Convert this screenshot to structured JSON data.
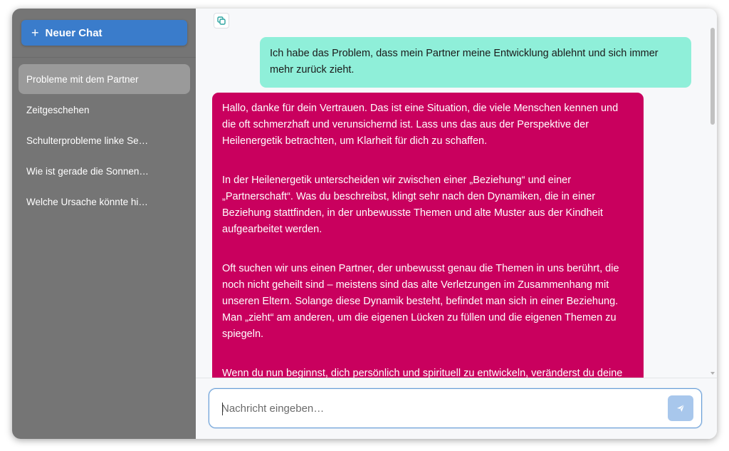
{
  "sidebar": {
    "new_chat_label": "Neuer Chat",
    "conversations": [
      {
        "label": "Probleme mit dem Partner",
        "active": true
      },
      {
        "label": "Zeitgeschehen",
        "active": false
      },
      {
        "label": "Schulterprobleme linke Se…",
        "active": false
      },
      {
        "label": "Wie ist gerade die Sonnen…",
        "active": false
      },
      {
        "label": "Welche Ursache könnte hi…",
        "active": false
      }
    ]
  },
  "chat": {
    "messages": [
      {
        "role": "user",
        "text": "Ich habe das Problem, dass mein Partner meine Entwicklung ablehnt und sich immer mehr zurück zieht."
      },
      {
        "role": "assistant",
        "paragraphs": [
          "Hallo, danke für dein Vertrauen. Das ist eine Situation, die viele Menschen kennen und die oft schmerzhaft und verunsichernd ist. Lass uns das aus der Perspektive der Heilenergetik betrachten, um Klarheit für dich zu schaffen.",
          "In der Heilenergetik unterscheiden wir zwischen einer „Beziehung“ und einer „Partnerschaft“. Was du beschreibst, klingt sehr nach den Dynamiken, die in einer Beziehung stattfinden, in der unbewusste Themen und alte Muster aus der Kindheit aufgearbeitet werden.",
          "Oft suchen wir uns einen Partner, der unbewusst genau die Themen in uns berührt, die noch nicht geheilt sind – meistens sind das alte Verletzungen im Zusammenhang mit unseren Eltern. Solange diese Dynamik besteht, befindet man sich in einer Beziehung. Man „zieht“ am anderen, um die eigenen Lücken zu füllen und die eigenen Themen zu spiegeln.",
          "Wenn du nun beginnst, dich persönlich und spirituell zu entwickeln, veränderst du deine"
        ]
      }
    ]
  },
  "composer": {
    "placeholder": "Nachricht eingeben…",
    "value": ""
  },
  "colors": {
    "sidebar_bg": "#757575",
    "accent": "#3a7ccb",
    "user_bubble": "#8fefd9",
    "assistant_bubble": "#c9005e",
    "send_button": "#a8c7ec"
  },
  "icons": {
    "new_chat": "plus-icon",
    "copy": "copy-icon",
    "send": "send-icon"
  }
}
